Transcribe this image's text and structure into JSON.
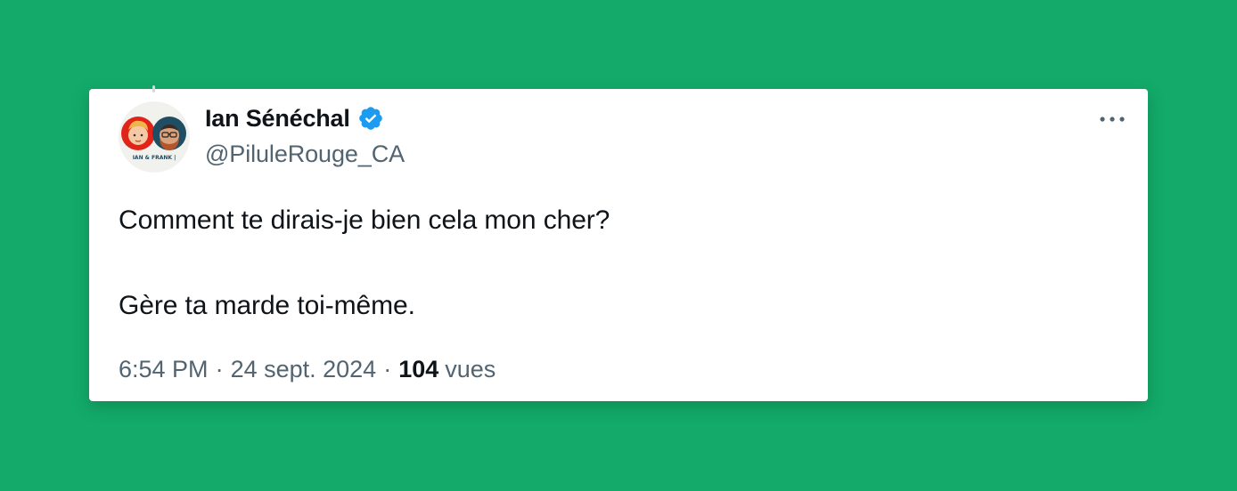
{
  "tweet": {
    "author": {
      "display_name": "Ian Sénéchal",
      "handle": "@PiluleRouge_CA",
      "verified": true,
      "avatar_caption": "IAN & FRANK |"
    },
    "text_line_1": "Comment te dirais-je bien cela mon cher?",
    "text_line_2": "Gère ta marde toi-même.",
    "time": "6:54 PM",
    "separator": "·",
    "date": "24 sept. 2024",
    "views_count": "104",
    "views_label": "vues"
  },
  "icons": {
    "verified": "verified-badge-icon",
    "more": "more-options-icon"
  },
  "colors": {
    "background": "#13aa6a",
    "card": "#ffffff",
    "verified_blue": "#1d9bf0",
    "text_primary": "#0f1419",
    "text_secondary": "#536471"
  }
}
